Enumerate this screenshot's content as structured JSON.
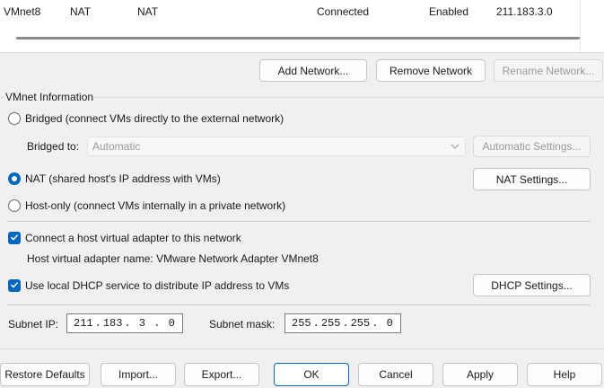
{
  "network_table": {
    "rows": [
      {
        "name": "VMnet8",
        "type": "NAT",
        "external": "NAT",
        "host_connection": "Connected",
        "dhcp": "Enabled",
        "subnet": "211.183.3.0"
      }
    ]
  },
  "network_buttons": {
    "add": "Add Network...",
    "remove": "Remove Network",
    "rename": "Rename Network..."
  },
  "vmnet_info": {
    "title": "VMnet Information",
    "bridged_label": "Bridged (connect VMs directly to the external network)",
    "bridged_to_label": "Bridged to:",
    "bridged_to_value": "Automatic",
    "automatic_settings": "Automatic Settings...",
    "nat_label": "NAT (shared host's IP address with VMs)",
    "nat_settings": "NAT Settings...",
    "host_only_label": "Host-only (connect VMs internally in a private network)",
    "connect_adapter_label": "Connect a host virtual adapter to this network",
    "adapter_name_label": "Host virtual adapter name: VMware Network Adapter VMnet8",
    "dhcp_label": "Use local DHCP service to distribute IP address to VMs",
    "dhcp_settings": "DHCP Settings...",
    "subnet_ip_label": "Subnet IP:",
    "subnet_ip": [
      "211",
      "183",
      "3",
      "0"
    ],
    "subnet_mask_label": "Subnet mask:",
    "subnet_mask": [
      "255",
      "255",
      "255",
      "0"
    ],
    "selected_mode": "NAT",
    "connect_adapter_checked": true,
    "dhcp_checked": true
  },
  "footer": {
    "restore": "Restore Defaults",
    "import": "Import...",
    "export": "Export...",
    "ok": "OK",
    "cancel": "Cancel",
    "apply": "Apply",
    "help": "Help"
  },
  "colors": {
    "accent": "#0067c0",
    "background": "#f0f0f0"
  },
  "icons": {
    "dropdown": "chevron-down-icon",
    "checkbox": "checkmark-icon",
    "radio": "radio-dot-icon"
  }
}
